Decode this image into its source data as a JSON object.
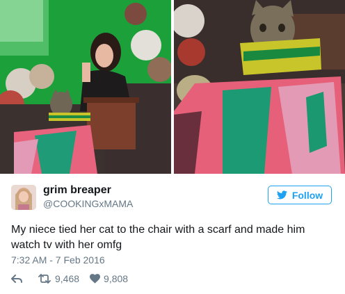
{
  "user": {
    "display_name": "grim breaper",
    "handle": "@COOKINGxMAMA",
    "avatar_icon": "profile-photo"
  },
  "follow": {
    "label": "Follow",
    "icon": "twitter-bird-icon"
  },
  "tweet": {
    "text": "My niece tied her cat to the chair with a scarf and made him watch tv with her omfg",
    "timestamp": "7:32 AM - 7 Feb 2016"
  },
  "actions": {
    "reply_icon": "reply-icon",
    "retweet_icon": "retweet-icon",
    "retweets": "9,468",
    "like_icon": "heart-icon",
    "likes": "9,808"
  },
  "photos": [
    {
      "name": "girl-with-cat-photo"
    },
    {
      "name": "cat-in-scarf-closeup-photo"
    }
  ],
  "colors": {
    "accent": "#1da1f2",
    "text": "#14171a",
    "muted": "#657786",
    "wall_green": "#1bab3a"
  }
}
